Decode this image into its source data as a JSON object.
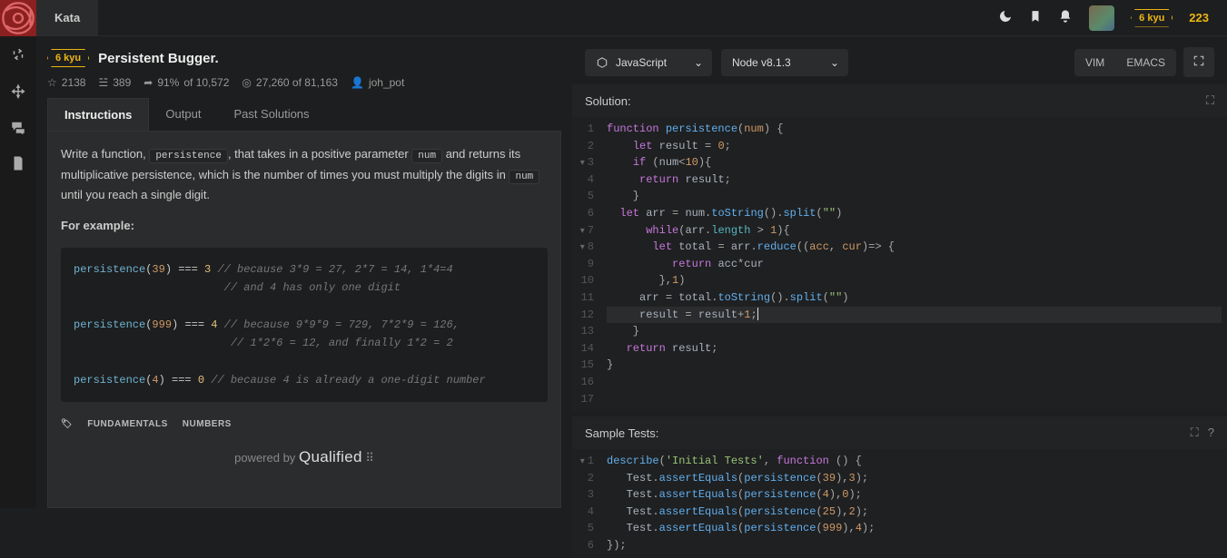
{
  "topbar": {
    "tab_label": "Kata",
    "kyu": "6 kyu",
    "score": "223"
  },
  "kata": {
    "kyu": "6 kyu",
    "title": "Persistent Bugger.",
    "stats": {
      "stars": "2138",
      "collected": "389",
      "satisfaction_pct": "91%",
      "satisfaction_of": "of 10,572",
      "completed": "27,260 of 81,163",
      "author": "joh_pot"
    }
  },
  "tabs": {
    "instructions": "Instructions",
    "output": "Output",
    "past": "Past Solutions"
  },
  "instructions": {
    "p1a": "Write a function, ",
    "p1_code": "persistence",
    "p1b": ", that takes in a positive parameter ",
    "p1_code2": "num",
    "p1c": " and returns its multiplicative persistence, which is the number of times you must multiply the digits in ",
    "p1_code3": "num",
    "p1d": " until you reach a single digit.",
    "example_label": "For example:",
    "tags": [
      "FUNDAMENTALS",
      "NUMBERS"
    ],
    "powered_pre": "powered by",
    "powered_brand": "Qualified"
  },
  "editor": {
    "lang": "JavaScript",
    "runtime": "Node v8.1.3",
    "mode_vim": "VIM",
    "mode_emacs": "EMACS",
    "solution_header": "Solution:",
    "tests_header": "Sample Tests:"
  }
}
